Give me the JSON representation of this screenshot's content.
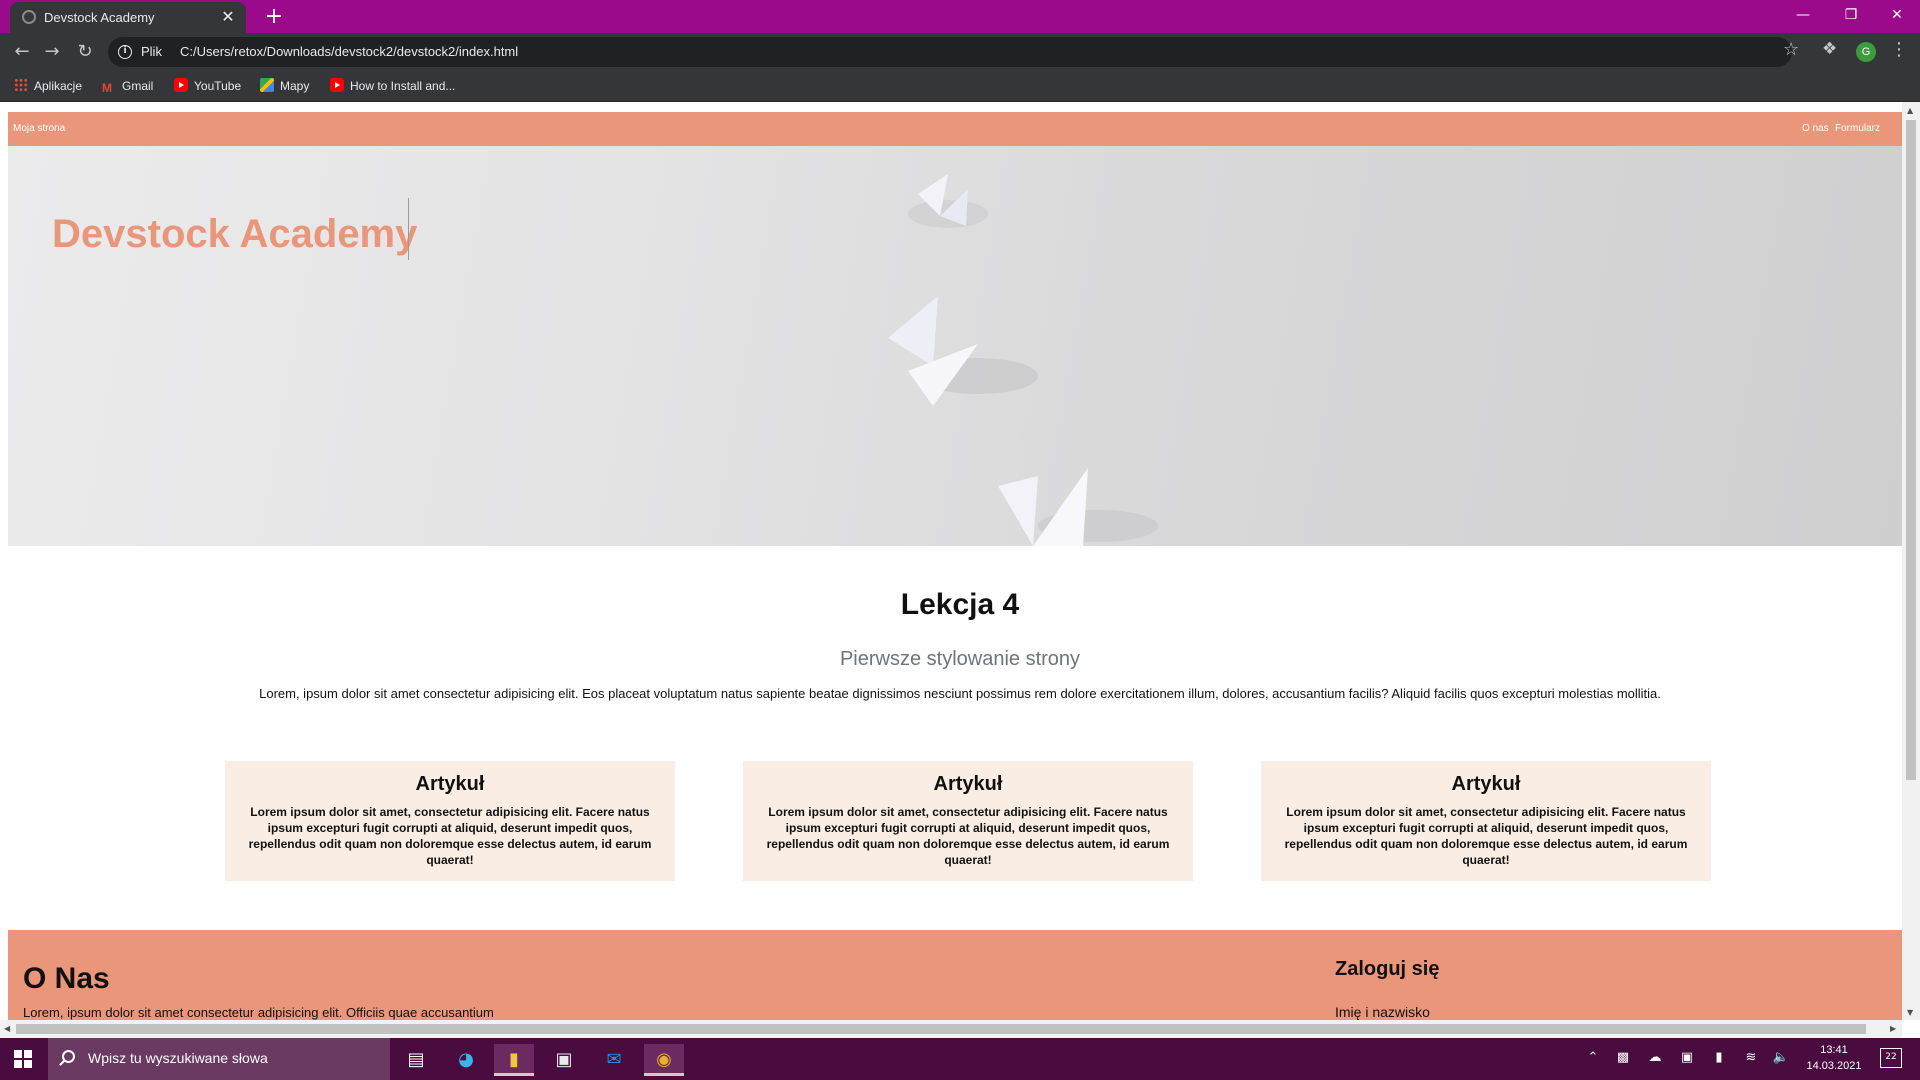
{
  "browser": {
    "tab_title": "Devstock Academy",
    "tab_close": "✕",
    "new_tab": "+",
    "scheme_label": "Plik",
    "url": "C:/Users/retox/Downloads/devstock2/devstock2/index.html",
    "profile_initial": "G",
    "titlebar_color": "#9a0a8a",
    "bookmarks": [
      {
        "label": "Aplikacje",
        "icon": "apps-grid-icon"
      },
      {
        "label": "Gmail",
        "icon": "gmail-icon"
      },
      {
        "label": "YouTube",
        "icon": "youtube-icon"
      },
      {
        "label": "Mapy",
        "icon": "maps-icon"
      },
      {
        "label": "How to Install and...",
        "icon": "youtube-icon"
      }
    ]
  },
  "page": {
    "accent_color": "#e9967a",
    "nav": {
      "brand": "Moja strona",
      "links": [
        "O nas",
        "Formularz"
      ]
    },
    "hero": {
      "title": "Devstock Academy"
    },
    "lesson": {
      "title": "Lekcja 4",
      "subtitle": "Pierwsze stylowanie strony",
      "text": "Lorem, ipsum dolor sit amet consectetur adipisicing elit. Eos placeat voluptatum natus sapiente beatae dignissimos nesciunt possimus rem dolore exercitationem illum, dolores, accusantium facilis? Aliquid facilis quos excepturi molestias mollitia."
    },
    "cards": [
      {
        "title": "Artykuł",
        "text": "Lorem ipsum dolor sit amet, consectetur adipisicing elit. Facere natus ipsum excepturi fugit corrupti at aliquid, deserunt impedit quos, repellendus odit quam non doloremque esse delectus autem, id earum quaerat!"
      },
      {
        "title": "Artykuł",
        "text": "Lorem ipsum dolor sit amet, consectetur adipisicing elit. Facere natus ipsum excepturi fugit corrupti at aliquid, deserunt impedit quos, repellendus odit quam non doloremque esse delectus autem, id earum quaerat!"
      },
      {
        "title": "Artykuł",
        "text": "Lorem ipsum dolor sit amet, consectetur adipisicing elit. Facere natus ipsum excepturi fugit corrupti at aliquid, deserunt impedit quos, repellendus odit quam non doloremque esse delectus autem, id earum quaerat!"
      }
    ],
    "footer": {
      "about_title": "O Nas",
      "about_text": "Lorem, ipsum dolor sit amet consectetur adipisicing elit. Officiis quae accusantium",
      "login_title": "Zaloguj się",
      "login_field_label": "Imię i nazwisko"
    }
  },
  "taskbar": {
    "search_placeholder": "Wpisz tu wyszukiwane słowa",
    "time": "13:41",
    "date": "14.03.2021",
    "notification_count": "22",
    "color": "#4a0b3f"
  }
}
